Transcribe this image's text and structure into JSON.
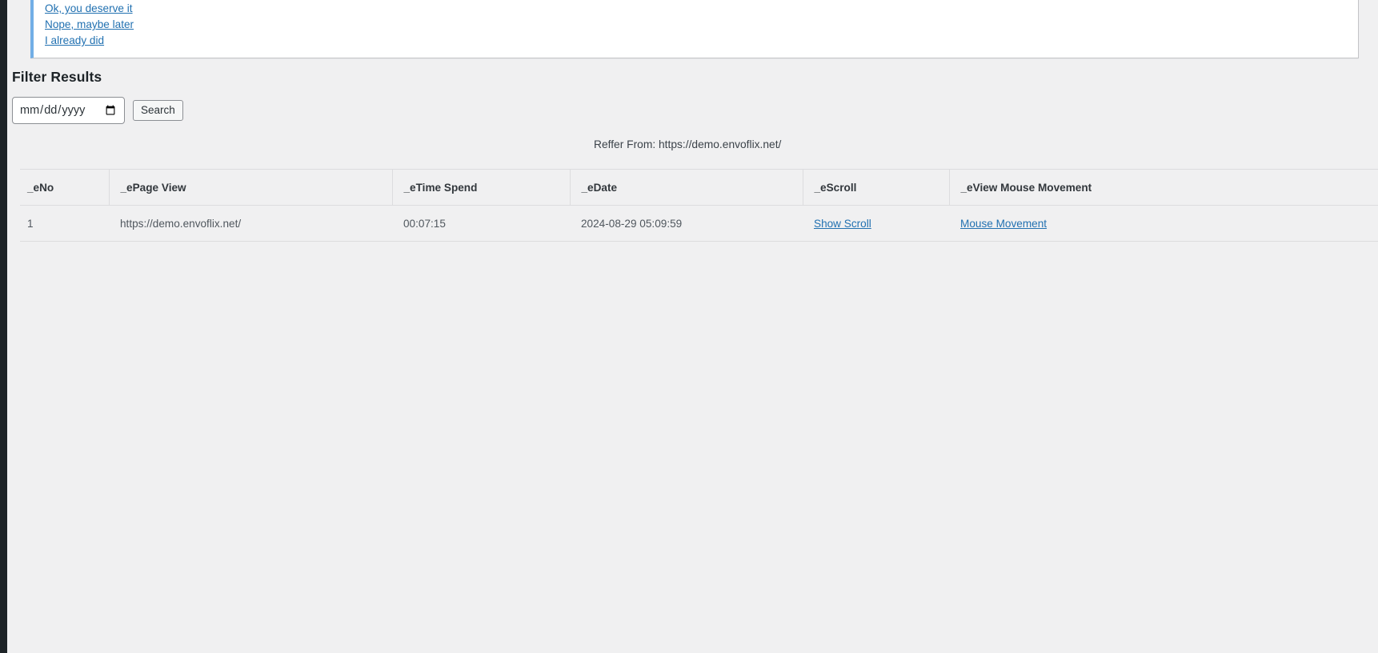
{
  "notice": {
    "links": [
      {
        "label": "Ok, you deserve it"
      },
      {
        "label": "Nope, maybe later"
      },
      {
        "label": "I already did"
      }
    ]
  },
  "filter": {
    "title": "Filter Results",
    "date_placeholder": "mm/dd/yyyy",
    "date_value": "",
    "search_label": "Search"
  },
  "referrer": {
    "text": "Reffer From: https://demo.envoflix.net/"
  },
  "table": {
    "columns": [
      {
        "key": "no",
        "label": "_eNo"
      },
      {
        "key": "page",
        "label": "_ePage View"
      },
      {
        "key": "time",
        "label": "_eTime Spend"
      },
      {
        "key": "date",
        "label": "_eDate"
      },
      {
        "key": "scroll",
        "label": "_eScroll"
      },
      {
        "key": "mouse",
        "label": "_eView Mouse Movement"
      }
    ],
    "rows": [
      {
        "no": "1",
        "page": "https://demo.envoflix.net/",
        "time": "00:07:15",
        "date": "2024-08-29 05:09:59",
        "scroll": "Show Scroll",
        "mouse": "Mouse Movement"
      }
    ]
  },
  "colors": {
    "admin_rail": "#1d2327",
    "page_bg": "#f0f0f1",
    "link": "#2271b1",
    "notice_accent": "#72aee6",
    "border": "#dcdcde"
  }
}
